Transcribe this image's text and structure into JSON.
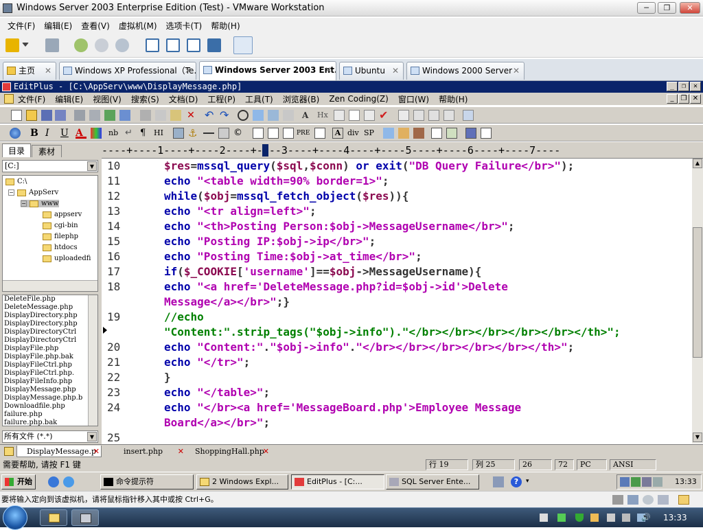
{
  "vmware": {
    "title": "Windows Server 2003 Enterprise Edition (Test) - VMware Workstation",
    "menu": [
      "文件(F)",
      "编辑(E)",
      "查看(V)",
      "虚拟机(M)",
      "选项卡(T)",
      "帮助(H)"
    ],
    "tabs": [
      {
        "label": "主页"
      },
      {
        "label": "Windows XP Professional（Te..."
      },
      {
        "label": "Windows Server 2003 Ent..."
      },
      {
        "label": "Ubuntu"
      },
      {
        "label": "Windows 2000 Server"
      }
    ],
    "close_glyph": "✕",
    "status_message": "要将输入定向到该虚拟机，请将鼠标指针移入其中或按 Ctrl+G。"
  },
  "editplus": {
    "title": "EditPlus - [C:\\AppServ\\www\\DisplayMessage.php]",
    "menu": [
      "文件(F)",
      "编辑(E)",
      "视图(V)",
      "搜索(S)",
      "文档(D)",
      "工程(P)",
      "工具(T)",
      "浏览器(B)",
      "Zen Coding(Z)",
      "窗口(W)",
      "帮助(H)"
    ],
    "toolbar2_text": {
      "bold": "B",
      "italic": "I",
      "underline": "U",
      "nb": "nb",
      "pilcrow": "¶",
      "hi": "HI",
      "pre": "PRE",
      "div": "div",
      "sp": "SP",
      "hx": "Hx"
    },
    "side_tabs": [
      "目录",
      "素材"
    ],
    "drive": "[C:]",
    "tree": [
      {
        "label": "C:\\",
        "indent": 0
      },
      {
        "label": "AppServ",
        "indent": 1
      },
      {
        "label": "www",
        "indent": 2
      },
      {
        "label": "appserv",
        "indent": 3
      },
      {
        "label": "cgi-bin",
        "indent": 3
      },
      {
        "label": "filephp",
        "indent": 3
      },
      {
        "label": "htdocs",
        "indent": 3
      },
      {
        "label": "uploadedfi",
        "indent": 3
      }
    ],
    "files": [
      "DeleteFile.php",
      "DeleteMessage.php",
      "DisplayDirectory.php",
      "DisplayDirectory.php",
      "DisplayDirectoryCtrl",
      "DisplayDirectoryCtrl",
      "DisplayFile.php",
      "DisplayFile.php.bak",
      "DisplayFileCtrl.php",
      "DisplayFileCtrl.php.",
      "DisplayFileInfo.php",
      "DisplayMessage.php",
      "DisplayMessage.php.b",
      "Downloadfile.php",
      "failure.php",
      "failure.php.bak"
    ],
    "filter": "所有文件 (*.*)",
    "ruler": "----+----1----+----2----+----3----+----4----+----5----+----6----+----7----",
    "code_lines": [
      {
        "num": "10",
        "tokens": [
          [
            "v",
            "$res"
          ],
          [
            "p",
            "="
          ],
          [
            "k",
            "mssql_query"
          ],
          [
            "p",
            "("
          ],
          [
            "v",
            "$sql"
          ],
          [
            "p",
            ","
          ],
          [
            "v",
            "$conn"
          ],
          [
            "p",
            ") "
          ],
          [
            "k",
            "or"
          ],
          [
            "p",
            " "
          ],
          [
            "k",
            "exit"
          ],
          [
            "p",
            "("
          ],
          [
            "s",
            "\"DB Query Failure</br>\""
          ],
          [
            "p",
            ");"
          ]
        ]
      },
      {
        "num": "11",
        "tokens": [
          [
            "k",
            "echo "
          ],
          [
            "s",
            "\"<table width=90% border=1>\""
          ],
          [
            "p",
            ";"
          ]
        ]
      },
      {
        "num": "12",
        "tokens": [
          [
            "k",
            "while"
          ],
          [
            "p",
            "("
          ],
          [
            "v",
            "$obj"
          ],
          [
            "p",
            "="
          ],
          [
            "k",
            "mssql_fetch_object"
          ],
          [
            "p",
            "("
          ],
          [
            "v",
            "$res"
          ],
          [
            "p",
            "))"
          ],
          [
            "p",
            "{"
          ]
        ]
      },
      {
        "num": "13",
        "tokens": [
          [
            "k",
            "echo "
          ],
          [
            "s",
            "\"<tr align=left>\""
          ],
          [
            "p",
            ";"
          ]
        ]
      },
      {
        "num": "14",
        "tokens": [
          [
            "k",
            "echo "
          ],
          [
            "s",
            "\"<th>Posting Person:$obj->MessageUsername</br>\""
          ],
          [
            "p",
            ";"
          ]
        ]
      },
      {
        "num": "15",
        "tokens": [
          [
            "k",
            "echo "
          ],
          [
            "s",
            "\"Posting IP:$obj->ip</br>\""
          ],
          [
            "p",
            ";"
          ]
        ]
      },
      {
        "num": "16",
        "tokens": [
          [
            "k",
            "echo "
          ],
          [
            "s",
            "\"Posting Time:$obj->at_time</br>\""
          ],
          [
            "p",
            ";"
          ]
        ]
      },
      {
        "num": "17",
        "tokens": [
          [
            "k",
            "if"
          ],
          [
            "p",
            "("
          ],
          [
            "v",
            "$_COOKIE"
          ],
          [
            "p",
            "["
          ],
          [
            "s",
            "'username'"
          ],
          [
            "p",
            "]=="
          ],
          [
            "v",
            "$obj"
          ],
          [
            "p",
            "->MessageUsername){"
          ]
        ]
      },
      {
        "num": "18",
        "tokens": [
          [
            "k",
            "echo "
          ],
          [
            "s",
            "\"<a href='DeleteMessage.php?id=$obj->id'>Delete"
          ]
        ]
      },
      {
        "num": "",
        "tokens": [
          [
            "s",
            "Message</a></br>\""
          ],
          [
            "p",
            ";}"
          ]
        ]
      },
      {
        "num": "19",
        "tokens": [
          [
            "c",
            "//echo"
          ]
        ]
      },
      {
        "num": "",
        "tokens": [
          [
            "c",
            "\"Content:\".strip_tags(\"$obj->info\").\"</br></br></br></br></br></th>\";"
          ]
        ]
      },
      {
        "num": "20",
        "tokens": [
          [
            "k",
            "echo "
          ],
          [
            "s",
            "\"Content:\""
          ],
          [
            "p",
            "."
          ],
          [
            "s",
            "\"$obj->info\""
          ],
          [
            "p",
            "."
          ],
          [
            "s",
            "\"</br></br></br></br></br></th>\""
          ],
          [
            "p",
            ";"
          ]
        ]
      },
      {
        "num": "21",
        "tokens": [
          [
            "k",
            "echo "
          ],
          [
            "s",
            "\"</tr>\""
          ],
          [
            "p",
            ";"
          ]
        ]
      },
      {
        "num": "22",
        "tokens": [
          [
            "p",
            "}"
          ]
        ]
      },
      {
        "num": "23",
        "tokens": [
          [
            "k",
            "echo "
          ],
          [
            "s",
            "\"</table>\""
          ],
          [
            "p",
            ";"
          ]
        ]
      },
      {
        "num": "24",
        "tokens": [
          [
            "k",
            "echo "
          ],
          [
            "s",
            "\"</br><a href='MessageBoard.php'>Employee Message"
          ]
        ]
      },
      {
        "num": "",
        "tokens": [
          [
            "s",
            "Board</a></br>\""
          ],
          [
            "p",
            ";"
          ]
        ]
      },
      {
        "num": "25",
        "tokens": []
      }
    ],
    "file_tabs": [
      "DisplayMessage.p",
      "insert.php",
      "ShoppingHall.php"
    ],
    "status": {
      "help": "需要帮助, 请按 F1 键",
      "line": "行 19",
      "col": "列 25",
      "c1": "26",
      "c2": "72",
      "mode": "PC",
      "enc": "ANSI"
    }
  },
  "guest_taskbar": {
    "start": "开始",
    "items": [
      "命令提示符",
      "2 Windows Expl...",
      "EditPlus - [C:...",
      "SQL Server Ente..."
    ],
    "time": "13:33"
  },
  "host_taskbar": {
    "time": "13:33"
  }
}
